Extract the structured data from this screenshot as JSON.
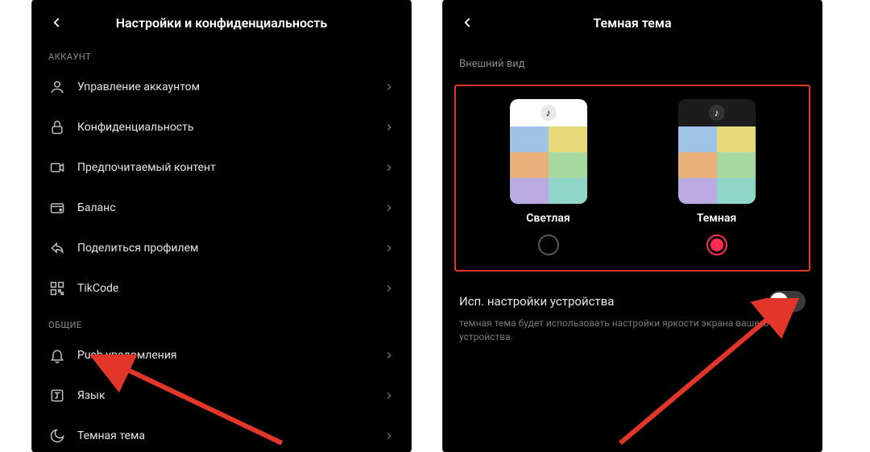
{
  "left": {
    "title": "Настройки и конфиденциальность",
    "section_account": "АККАУНТ",
    "section_general": "ОБЩИЕ",
    "items_account": [
      "Управление аккаунтом",
      "Конфиденциальность",
      "Предпочитаемый контент",
      "Баланс",
      "Поделиться профилем",
      "TikCode"
    ],
    "items_general": [
      "Push-уведомления",
      "Язык",
      "Темная тема"
    ]
  },
  "right": {
    "title": "Темная тема",
    "appearance": "Внешний вид",
    "light": "Светлая",
    "dark": "Темная",
    "toggle_label": "Исп. настройки устройства",
    "toggle_desc": "темная тема будет использовать настройки яркости экрана вашего устройства."
  }
}
